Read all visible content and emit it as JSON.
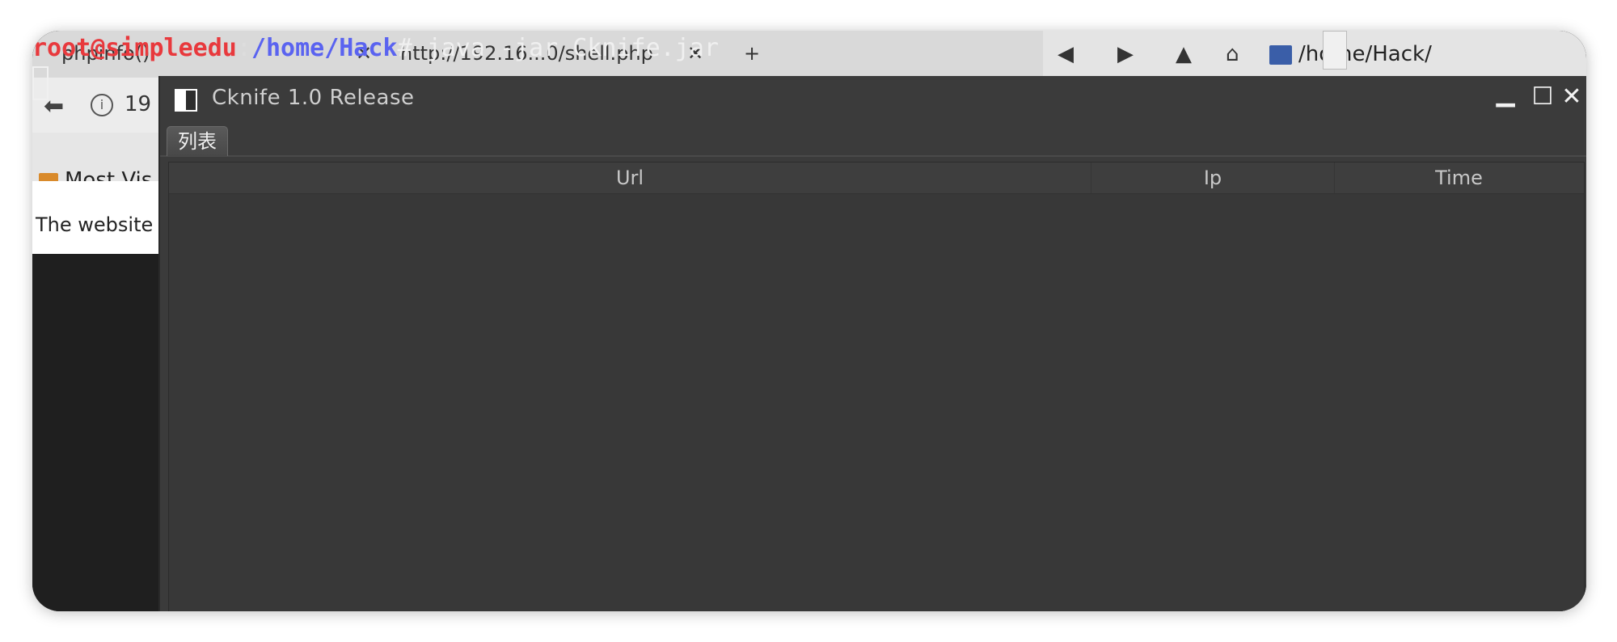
{
  "terminal": {
    "user_host": "root@simpleedu",
    "colon": ":",
    "path": "/home/Hack",
    "command": "# java -jar Cknife.jar"
  },
  "background_browser": {
    "tab1": "phpinfo()",
    "tab1_close": "✕",
    "tab2": "http://192.16...0/shell.php",
    "tab2_close": "✕",
    "url_fragment": "19",
    "bookmark": "Most Vis",
    "page_text": "The website"
  },
  "background_filemanager": {
    "path": "/home/Hack/"
  },
  "window": {
    "title": "Cknife 1.0 Release",
    "minimize": "▁",
    "maximize": "☐",
    "close": "✕"
  },
  "tabs": [
    {
      "label": "列表"
    }
  ],
  "table": {
    "columns": [
      "Url",
      "Ip",
      "Time"
    ]
  },
  "colors": {
    "user": "#e8393d",
    "path": "#5a63f0",
    "window_bg": "#3b3b3b"
  }
}
